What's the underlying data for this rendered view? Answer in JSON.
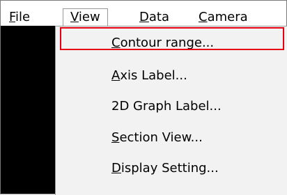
{
  "menubar": {
    "items": [
      {
        "prefix": "",
        "mnemonic": "F",
        "rest": "ile"
      },
      {
        "prefix": "",
        "mnemonic": "V",
        "rest": "iew"
      },
      {
        "prefix": "",
        "mnemonic": "D",
        "rest": "ata"
      },
      {
        "prefix": "",
        "mnemonic": "C",
        "rest": "amera"
      }
    ]
  },
  "dropdown": {
    "items": [
      {
        "mnemonic": "C",
        "rest": "ontour range..."
      },
      {
        "mnemonic": "A",
        "rest": "xis Label..."
      },
      {
        "mnemonic": "",
        "rest": "2D Graph Label..."
      },
      {
        "mnemonic": "S",
        "rest": "ection View..."
      },
      {
        "mnemonic": "D",
        "rest": "isplay Setting..."
      }
    ],
    "highlighted_index": 0
  },
  "colors": {
    "highlight": "#e60012",
    "dropdown_bg": "#f2f2f2",
    "canvas_bg": "#000000"
  }
}
